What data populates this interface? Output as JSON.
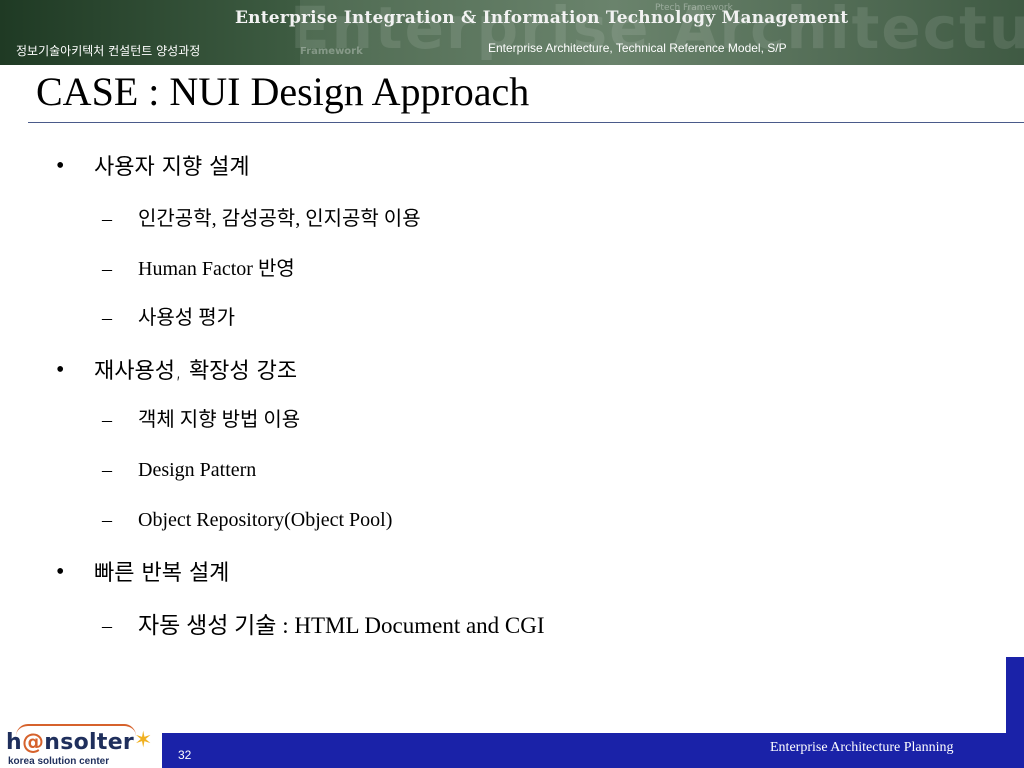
{
  "header": {
    "banner_title": "Enterprise Integration & Information Technology Management",
    "course_name": "정보기술아키텍처 컨설턴트 양성과정",
    "subtitle": "Enterprise Architecture, Technical Reference Model, S/P",
    "watermark": "Enterprise Architecture Mod",
    "watermark_small": "Framework",
    "watermark_small2": "Ptech Framework"
  },
  "slide": {
    "title": "CASE : NUI Design Approach"
  },
  "bullets": [
    {
      "level": 1,
      "marker": "•",
      "text": "사용자 지향 설계"
    },
    {
      "level": 2,
      "marker": "–",
      "text": "인간공학, 감성공학, 인지공학 이용"
    },
    {
      "level": 2,
      "marker": "–",
      "text": "Human Factor 반영"
    },
    {
      "level": 2,
      "marker": "–",
      "text": "사용성 평가"
    },
    {
      "level": 1,
      "marker": "•",
      "text": "재사용성, 확장성 강조"
    },
    {
      "level": 2,
      "marker": "–",
      "text": "객체 지향 방법 이용"
    },
    {
      "level": 2,
      "marker": "–",
      "text": "Design Pattern"
    },
    {
      "level": 2,
      "marker": "–",
      "text": "Object Repository(Object Pool)"
    },
    {
      "level": 1,
      "marker": "•",
      "text": "빠른 반복 설계"
    },
    {
      "level": 2,
      "marker": "–",
      "text": "자동 생성 기술 : HTML Document and CGI"
    }
  ],
  "footer": {
    "page_number": "32",
    "right_text": "Enterprise Architecture Planning",
    "logo_text_a": "h",
    "logo_text_at": "@",
    "logo_text_b": "nsolter",
    "logo_sub": "korea solution center",
    "bar_color": "#1a22a8"
  }
}
